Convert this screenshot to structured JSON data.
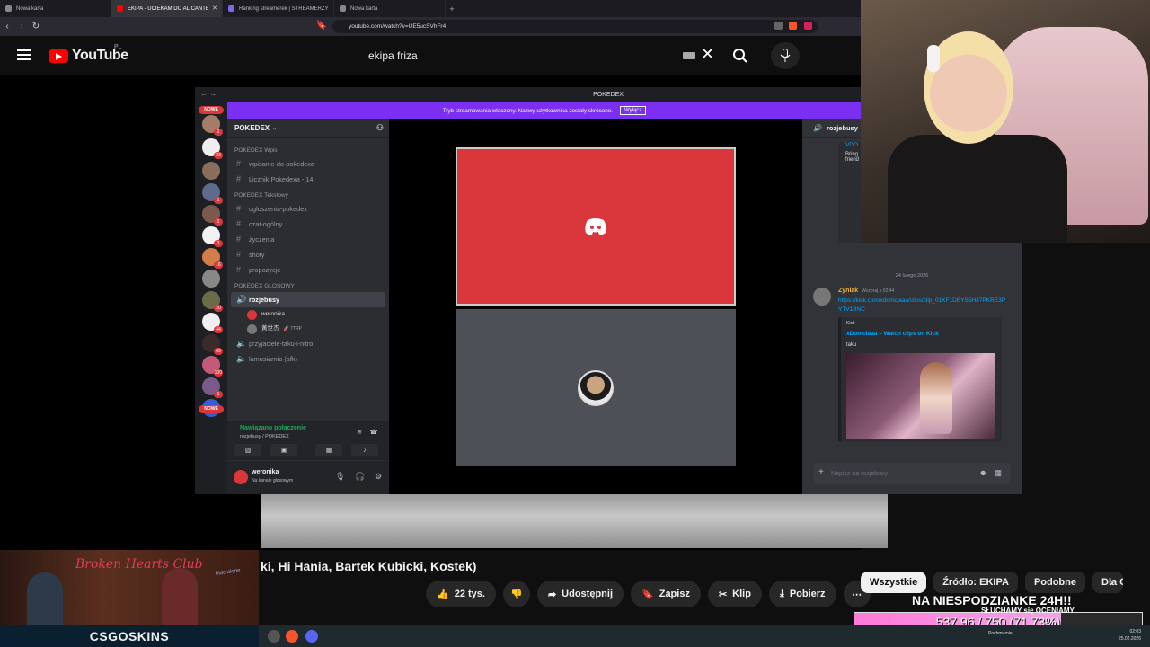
{
  "browser": {
    "tabs": [
      {
        "label": "Nowa karta",
        "icon": "globe-icon",
        "active": false
      },
      {
        "label": "EKIPA - UCIEKAM DO ALICANTE",
        "icon": "youtube-icon",
        "active": true
      },
      {
        "label": "Ranking streamerek | STREAMERZY.pl",
        "icon": "ranking-icon",
        "active": false
      },
      {
        "label": "Nowa karta",
        "icon": "globe-icon",
        "active": false
      }
    ],
    "url": "youtube.com/watch?v=UE5ucSVhFr4"
  },
  "youtube": {
    "logo_text": "YouTube",
    "country_code": "PL",
    "search_value": "ekipa friza",
    "video_title": "ki, Hi Hania, Bartek Kubicki, Kostek)",
    "actions": {
      "like_count": "22 tys.",
      "share": "Udostępnij",
      "save": "Zapisz",
      "clip": "Klip",
      "download": "Pobierz"
    },
    "chips": [
      "Wszystkie",
      "Źródło: EKIPA",
      "Podobne",
      "Dla C"
    ]
  },
  "discord": {
    "window_title": "POKEDEX",
    "banner_text": "Tryb streamowania włączony. Nazwy użytkownika zostały skrócone.",
    "banner_button": "Wyłącz",
    "guild_name": "POKEDEX",
    "new_label": "NOWE",
    "server_badges": [
      "1",
      "23",
      "",
      "1",
      "1",
      "3",
      "16",
      "",
      "",
      "20",
      "44",
      "69",
      "100",
      "1"
    ],
    "categories": {
      "info": "POKEDEX Wpis",
      "text": "POKEDEX Tekstowy",
      "voice": "POKEDEX GŁOSOWY"
    },
    "info_channels": [
      "wpisanie-do-pokedexa",
      "Licznik Pokedexa - 14"
    ],
    "text_channels": [
      "ogloszenia-pokedex",
      "czat-ogólny",
      "życzenia",
      "shoty",
      "propozycje"
    ],
    "voice_channels": {
      "active": "rozjebusy",
      "members": [
        {
          "name": "weronika",
          "tag": ""
        },
        {
          "name": "黃世杰",
          "tag": "🚀 7TRP"
        }
      ],
      "others": [
        "przyjaciele-taku-i-nitro",
        "lamusiarnia (afk)"
      ]
    },
    "voice_status": "Nawiązano połączenie",
    "voice_sub": "rozjebusy / POKEDEX",
    "user": {
      "name": "weronika",
      "status": "Na kanale głosowym"
    },
    "chat": {
      "channel": "rozjebusy",
      "top_link": "VDO.",
      "top_text_1": "Bring",
      "top_text_2": "friend",
      "date": "24 lutego 2026",
      "message": {
        "author": "Zyniak",
        "time": "Wczoraj o 02:44",
        "link": "https://kick.com/xdomciaaa/clips/clip_01KF1DEYS5H37PKRE3PYTV1BNC",
        "embed_provider": "Kick",
        "embed_title": "xDomciaaa – Watch clips on Kick",
        "embed_desc": "taku"
      },
      "input_placeholder": "Napisz na rozjebusy"
    }
  },
  "promo": {
    "title": "Broken Hearts Club",
    "sign": "hide alone",
    "brand": "CSGOSKINS"
  },
  "goal": {
    "title": "NA NIESPODZIANKE 24H!!",
    "note": "SŁUCHAMY się OCENIAMY",
    "current": 537.96,
    "target": 750,
    "label": "537.96 / 750 (71.73%)",
    "fraction": 0.7173
  },
  "taskbar": {
    "weather": "Pochmurnie",
    "time": "02:03",
    "date": "25.02.2026"
  }
}
